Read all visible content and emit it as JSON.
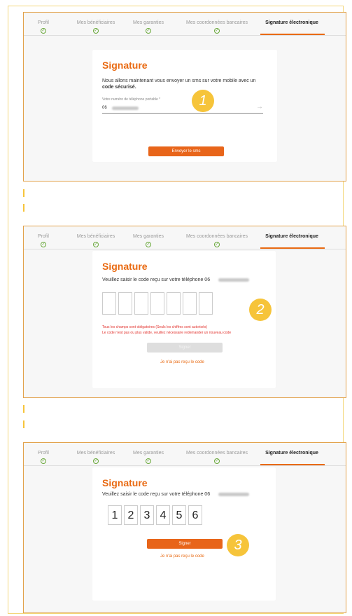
{
  "tabs": [
    {
      "label": "Profil",
      "check": true
    },
    {
      "label": "Mes bénéficiaires",
      "check": true
    },
    {
      "label": "Mes garanties",
      "check": true
    },
    {
      "label": "Mes coordonnées bancaires",
      "check": true
    },
    {
      "label": "Signature électronique",
      "check": false
    }
  ],
  "step1": {
    "badge": "1",
    "title": "Signature",
    "intro_line1": "Nous allons maintenant vous envoyer un sms sur votre mobile avec un",
    "intro_line2": "code sécurisé.",
    "phone_label": "Votre numéro de téléphone portable *",
    "phone_prefix": "06",
    "button": "Envoyer le sms",
    "arrow": "→"
  },
  "step2": {
    "badge": "2",
    "title": "Signature",
    "instruction": "Veuillez saisir le code reçu sur votre téléphone 06",
    "error_line1": "Tous les champs sont obligatoires (Seuls les chiffres sont autorisés)",
    "error_line2": "Le code n'est pas ou plus valide, veuillez nécessaire redemander un nouveau code",
    "button": "Signer",
    "link": "Je n'ai pas reçu le code"
  },
  "step3": {
    "badge": "3",
    "title": "Signature",
    "instruction": "Veuillez saisir le code reçu sur votre téléphone 06",
    "digits": [
      "1",
      "2",
      "3",
      "4",
      "5",
      "6"
    ],
    "button": "Signer",
    "link": "Je n'ai pas reçu le code"
  },
  "colors": {
    "accent": "#e96a12",
    "badge": "#f6c43a",
    "check": "#69a83a",
    "error": "#e2332e"
  },
  "icons": [
    "check-circle-icon",
    "arrow-right-icon"
  ]
}
